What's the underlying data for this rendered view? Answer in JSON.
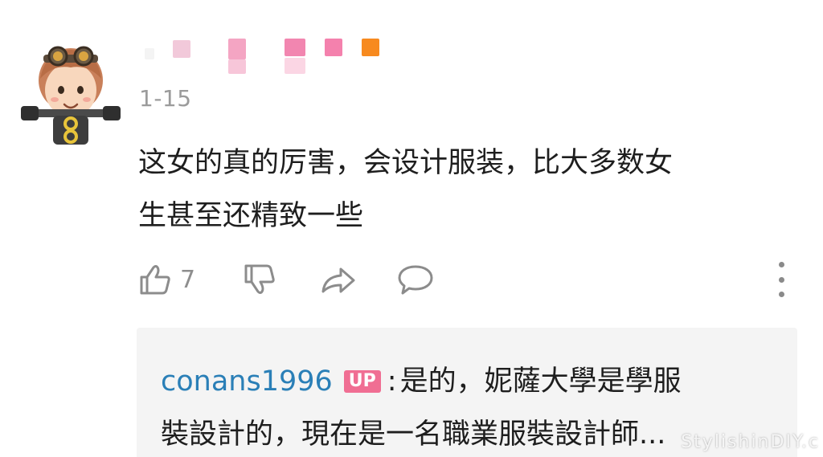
{
  "comment": {
    "date": "1-15",
    "text_line1": "这女的真的厉害，会设计服装，比大多数女",
    "text_line2": "生甚至还精致一些",
    "like_count": "7"
  },
  "icons": {
    "like": "thumbs-up-icon",
    "dislike": "thumbs-down-icon",
    "share": "share-icon",
    "reply": "comment-bubble-icon",
    "more": "more-vertical-icon"
  },
  "reply": {
    "username": "conans1996",
    "badge": "UP",
    "separator": ":",
    "text_line1": "是的，妮薩大學是學服",
    "text_line2": "裝設計的，現在是一名職業服裝設計師..."
  },
  "watermark": "StylishinDIY.c",
  "colors": {
    "username_link": "#2a7fb7",
    "up_badge": "#f06e93",
    "reply_bg": "#f4f4f4",
    "date": "#9b9b9b"
  }
}
